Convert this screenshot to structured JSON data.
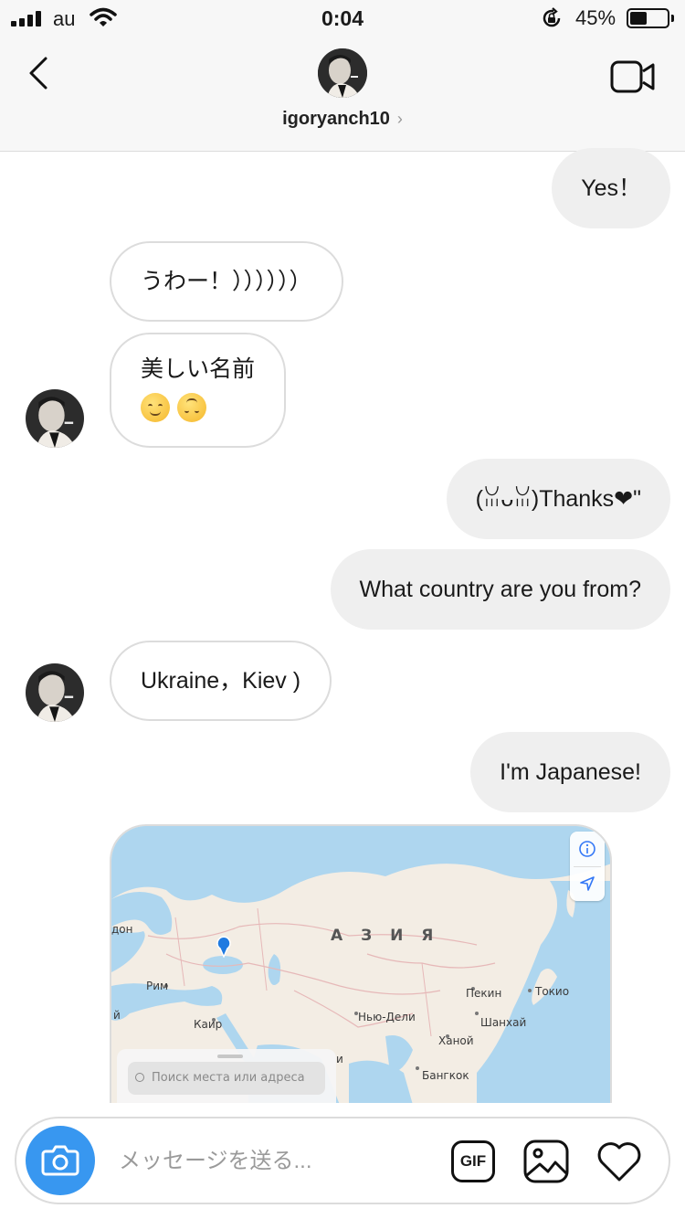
{
  "status_bar": {
    "carrier": "au",
    "time": "0:04",
    "battery_text": "45%",
    "battery_level": 0.45,
    "signal_icon": "signal-bars-icon",
    "wifi_icon": "wifi-icon",
    "lock_icon": "orientation-lock-icon"
  },
  "header": {
    "back_icon": "chevron-left-icon",
    "username": "igoryanch10",
    "chevron": "›",
    "video_icon": "video-camera-icon"
  },
  "messages": [
    {
      "id": "m1",
      "direction": "outgoing",
      "text": "Yes！"
    },
    {
      "id": "m2",
      "direction": "incoming",
      "text": "うわー！））））））"
    },
    {
      "id": "m3",
      "direction": "incoming",
      "text": "美しい名前",
      "emojis": [
        "relieved-face-emoji",
        "upside-down-face-emoji"
      ]
    },
    {
      "id": "m4",
      "direction": "outgoing",
      "text": "(ꈍᴗꈍ)Thanks❤\""
    },
    {
      "id": "m5",
      "direction": "outgoing",
      "text": "What country are you from?"
    },
    {
      "id": "m6",
      "direction": "incoming",
      "text": "Ukraine，Kiev )"
    },
    {
      "id": "m7",
      "direction": "outgoing",
      "text": "I'm Japanese!"
    }
  ],
  "map": {
    "labels": {
      "asia": "А З И Я",
      "london": "дон",
      "rome": "Рим",
      "cairo": "Каир",
      "delhi": "Нью-Дели",
      "beijing": "Пекин",
      "tokyo": "Токио",
      "shanghai": "Шанхай",
      "hanoi": "Ханой",
      "bangkok": "Бангкок",
      "yi": "й",
      "i": "и"
    },
    "search_placeholder": "Поиск места или адреса",
    "info_icon": "info-icon",
    "location_icon": "location-arrow-icon",
    "pin_icon": "location-pin-icon",
    "colors": {
      "land": "#f3ede4",
      "water": "#aed6ef",
      "pin": "#1f7ae0"
    }
  },
  "composer": {
    "camera_icon": "camera-icon",
    "placeholder": "メッセージを送る...",
    "gif_label": "GIF",
    "photo_icon": "photo-icon",
    "heart_icon": "heart-icon",
    "accent": "#3897f0"
  }
}
